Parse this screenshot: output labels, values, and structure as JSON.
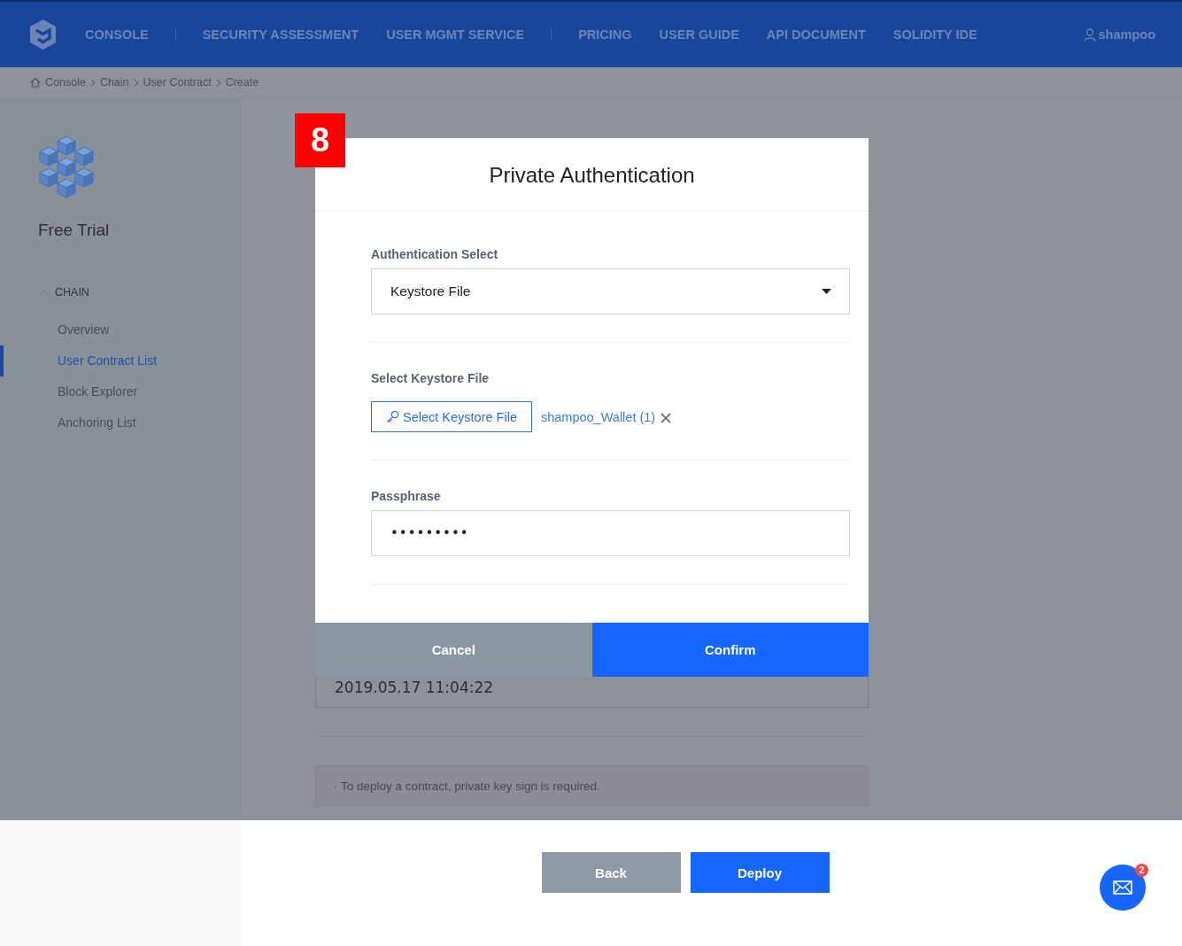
{
  "header": {
    "nav": [
      {
        "label": "CONSOLE",
        "separator_after": true
      },
      {
        "label": "SECURITY ASSESSMENT",
        "separator_after": false
      },
      {
        "label": "USER MGMT SERVICE",
        "separator_after": true
      },
      {
        "label": "PRICING",
        "separator_after": false
      },
      {
        "label": "USER GUIDE",
        "separator_after": false
      },
      {
        "label": "API DOCUMENT",
        "separator_after": false
      },
      {
        "label": "SOLIDITY IDE",
        "separator_after": false
      }
    ],
    "user": "shampoo"
  },
  "breadcrumb": [
    "Console",
    "Chain",
    "User Contract",
    "Create"
  ],
  "sidebar": {
    "plan": "Free Trial",
    "section": {
      "label": "CHAIN",
      "expanded": true
    },
    "items": [
      {
        "label": "Overview",
        "selected": false
      },
      {
        "label": "User Contract List",
        "selected": true
      },
      {
        "label": "Block Explorer",
        "selected": false
      },
      {
        "label": "Anchoring List",
        "selected": false
      }
    ]
  },
  "page": {
    "date_value": "2019.05.17 11:04:22",
    "notice": "· To deploy a contract, private key sign is required.",
    "buttons": [
      {
        "label": "Back",
        "kind": "secondary"
      },
      {
        "label": "Deploy",
        "kind": "primary"
      }
    ],
    "messages_badge": "2"
  },
  "step_badge": "8",
  "dialog": {
    "title": "Private Authentication",
    "auth_label": "Authentication Select",
    "auth_value": "Keystore File",
    "file_label": "Select Keystore File",
    "file_button": "Select Keystore File",
    "file_name": "shampoo_Wallet (1)",
    "pass_label": "Passphrase",
    "pass_value": "•••••••••",
    "buttons": [
      {
        "label": "Cancel",
        "kind": "secondary"
      },
      {
        "label": "Confirm",
        "kind": "primary"
      }
    ]
  }
}
